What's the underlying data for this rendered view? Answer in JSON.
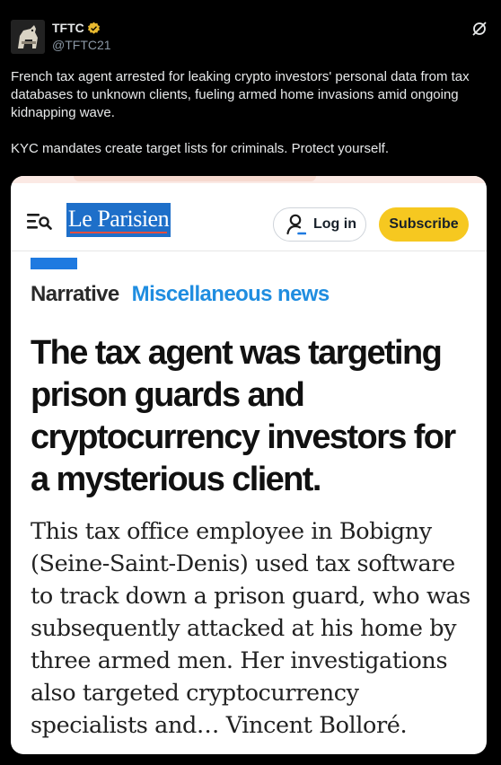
{
  "post": {
    "author_name": "TFTC",
    "author_handle": "@TFTC21",
    "text_paragraph_1": "French tax agent arrested for leaking crypto investors' personal data from tax databases to unknown clients, fueling armed home invasions amid ongoing kidnapping wave.",
    "text_paragraph_2": "KYC mandates create target lists for criminals. Protect yourself.",
    "icons": {
      "avatar": "horse-avatar-image",
      "verified": "verified-badge-icon",
      "more": "grok-slash-icon"
    }
  },
  "article": {
    "site_logo": "Le Parisien",
    "login_label": "Log in",
    "subscribe_label": "Subscribe",
    "category": "Narrative",
    "subcategory": "Miscellaneous news",
    "headline": "The tax agent was targeting prison guards and cryptocurrency investors for a mysterious client.",
    "lede": "This tax office employee in Bobigny (Seine-Saint-Denis) used tax software to track down a prison guard, who was subsequently attacked at his home by three armed men. Her investigations also targeted cryptocurrency specialists and… Vincent Bolloré.",
    "icons": {
      "menu": "menu-search-icon",
      "user": "user-icon"
    },
    "colors": {
      "logo_bg": "#1e6fc9",
      "subscribe_bg": "#f6c820",
      "accent": "#1f7ae0",
      "subcategory": "#1f8de0"
    }
  }
}
